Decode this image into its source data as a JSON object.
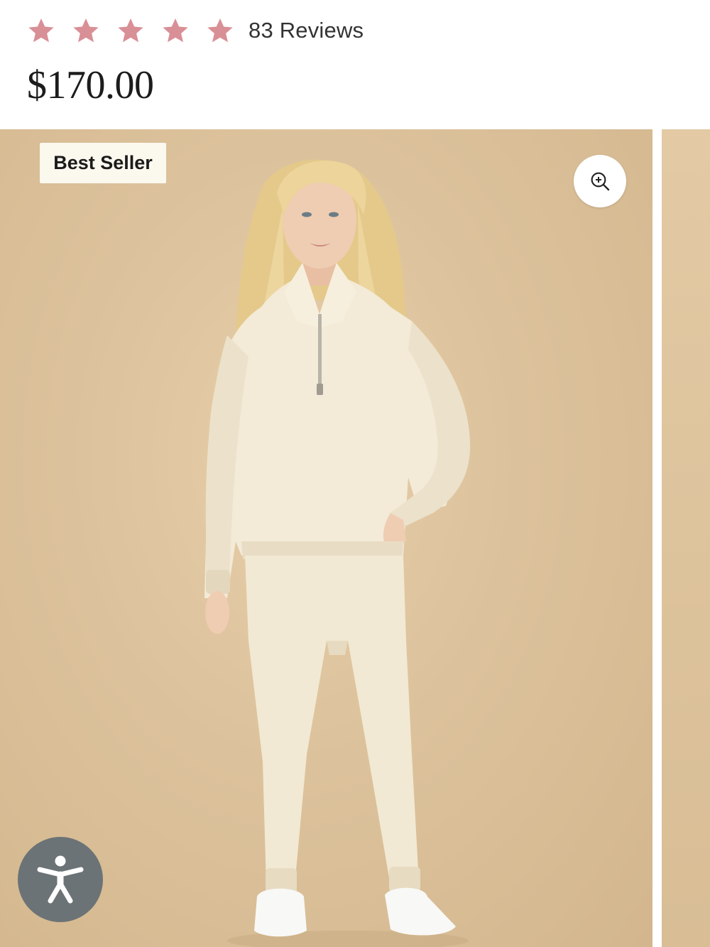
{
  "product": {
    "rating": 5,
    "reviews_label": "83 Reviews",
    "price": "$170.00"
  },
  "gallery": {
    "badge": "Best Seller",
    "zoom_icon": "zoom-in-icon",
    "model_image": "model-in-cream-half-zip-loungewear"
  },
  "accessibility": {
    "icon": "accessibility-person-icon"
  },
  "colors": {
    "star": "#d98f96",
    "background_photo": "#dcc29c",
    "badge_bg": "#fbf8ee",
    "a11y_button": "#6b7376"
  }
}
